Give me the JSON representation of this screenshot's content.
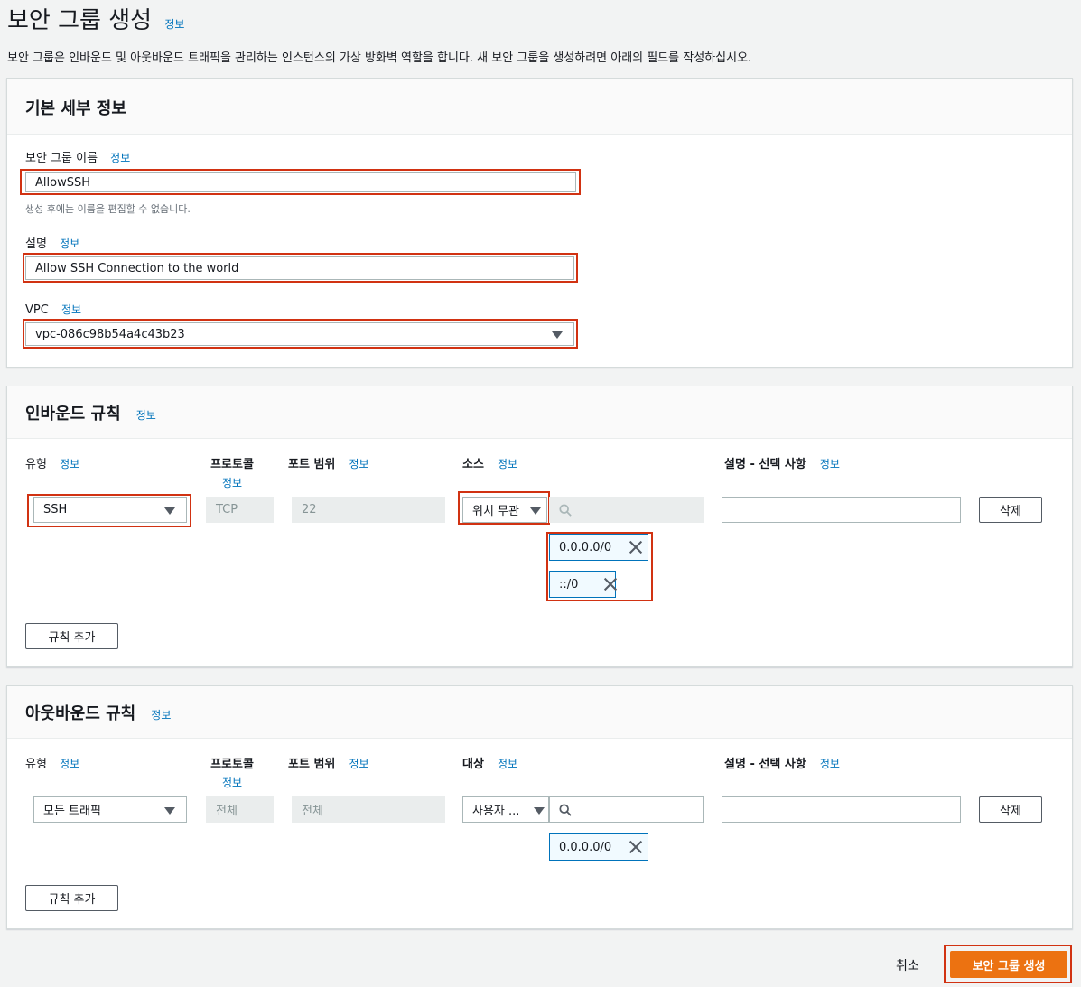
{
  "header": {
    "title": "보안 그룹 생성",
    "info": "정보",
    "description": "보안 그룹은 인바운드 및 아웃바운드 트래픽을 관리하는 인스턴스의 가상 방화벽 역할을 합니다. 새 보안 그룹을 생성하려면 아래의 필드를 작성하십시오."
  },
  "basic": {
    "title": "기본 세부 정보",
    "name_label": "보안 그룹 이름",
    "name_info": "정보",
    "name_value": "AllowSSH",
    "name_hint": "생성 후에는 이름을 편집할 수 없습니다.",
    "desc_label": "설명",
    "desc_info": "정보",
    "desc_value": "Allow SSH Connection to the world",
    "vpc_label": "VPC",
    "vpc_info": "정보",
    "vpc_value": "vpc-086c98b54a4c43b23"
  },
  "inbound": {
    "title": "인바운드 규칙",
    "info": "정보",
    "col_type": "유형",
    "col_type_info": "정보",
    "col_protocol": "프로토콜",
    "col_protocol_info": "정보",
    "col_port": "포트 범위",
    "col_port_info": "정보",
    "col_source": "소스",
    "col_source_info": "정보",
    "col_desc": "설명 - 선택 사항",
    "col_desc_info": "정보",
    "type_value": "SSH",
    "protocol_value": "TCP",
    "port_value": "22",
    "source_value": "위치 무관",
    "cidrs": [
      "0.0.0.0/0",
      "::/0"
    ],
    "delete_label": "삭제",
    "add_rule_label": "규칙 추가"
  },
  "outbound": {
    "title": "아웃바운드 규칙",
    "info": "정보",
    "col_type": "유형",
    "col_type_info": "정보",
    "col_protocol": "프로토콜",
    "col_protocol_info": "정보",
    "col_port": "포트 범위",
    "col_port_info": "정보",
    "col_dest": "대상",
    "col_dest_info": "정보",
    "col_desc": "설명 - 선택 사항",
    "col_desc_info": "정보",
    "type_value": "모든 트래픽",
    "protocol_value": "전체",
    "port_value": "전체",
    "dest_value": "사용자 ...",
    "cidrs": [
      "0.0.0.0/0"
    ],
    "delete_label": "삭제",
    "add_rule_label": "규칙 추가"
  },
  "footer": {
    "cancel_label": "취소",
    "create_label": "보안 그룹 생성"
  },
  "colors": {
    "primary": "#ec7211",
    "link": "#0073bb",
    "highlight": "#d13212"
  }
}
